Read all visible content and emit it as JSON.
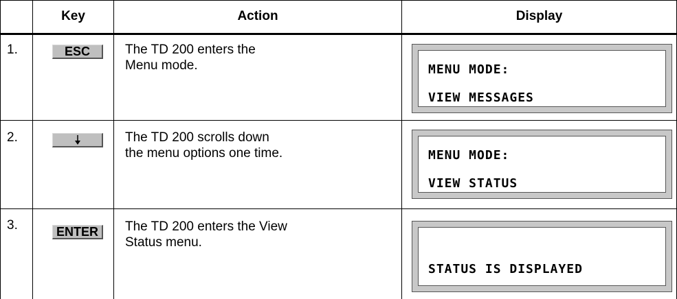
{
  "headers": {
    "key": "Key",
    "action": "Action",
    "display": "Display"
  },
  "rows": [
    {
      "num": "1.",
      "key": "ESC",
      "key_icon": null,
      "action": "The TD 200 enters the Menu mode.",
      "display": [
        "MENU MODE:",
        "VIEW MESSAGES"
      ]
    },
    {
      "num": "2.",
      "key": "",
      "key_icon": "down-arrow-icon",
      "action": "The TD 200 scrolls down the menu options one time.",
      "display": [
        "MENU MODE:",
        "VIEW STATUS"
      ]
    },
    {
      "num": "3.",
      "key": "ENTER",
      "key_icon": null,
      "action": "The TD 200 enters the View Status menu.",
      "display": [
        "",
        "STATUS IS DISPLAYED"
      ]
    }
  ]
}
